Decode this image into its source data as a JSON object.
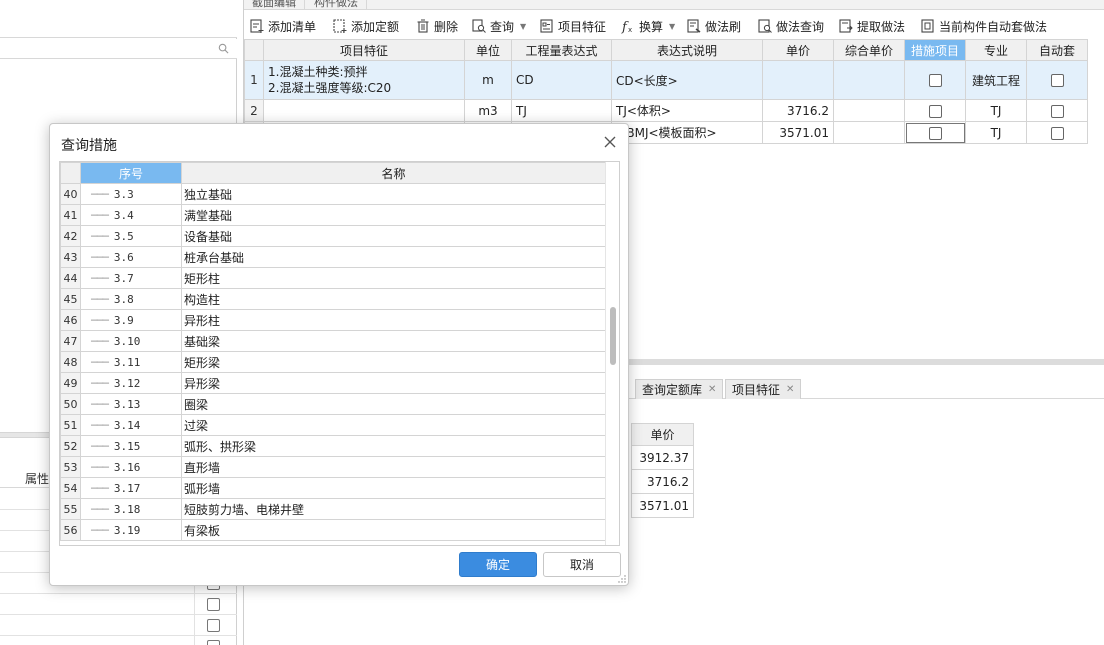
{
  "top_tabs": [
    "截面编辑",
    "构件做法"
  ],
  "toolbar": {
    "add_list": "添加清单",
    "add_quota": "添加定额",
    "delete": "删除",
    "query": "查询",
    "item_feature": "项目特征",
    "convert": "换算",
    "method_brush": "做法刷",
    "method_query": "做法查询",
    "extract_method": "提取做法",
    "auto_apply": "当前构件自动套做法"
  },
  "main_grid": {
    "headers": [
      "项目特征",
      "单位",
      "工程量表达式",
      "表达式说明",
      "单价",
      "综合单价",
      "措施项目",
      "专业",
      "自动套"
    ],
    "rows": [
      {
        "rn": "1",
        "feature_1": "1.混凝土种类:预拌",
        "feature_2": "2.混凝土强度等级:C20",
        "unit": "m",
        "expr": "CD",
        "expr_desc": "CD<长度>",
        "price": "",
        "major": "建筑工程"
      },
      {
        "rn": "2",
        "unit": "m3",
        "expr": "TJ",
        "expr_desc": "TJ<体积>",
        "price": "3716.2",
        "major": "TJ"
      },
      {
        "expr_desc": "MBMJ<模板面积>",
        "price": "3571.01",
        "major": "TJ"
      }
    ]
  },
  "left_panel": {
    "search_placeholder": "",
    "props_header": "属性"
  },
  "bottom_tabs": [
    "查询定额库",
    "项目特征"
  ],
  "bottom_grid": {
    "header": "单价",
    "values": [
      "3912.37",
      "3716.2",
      "3571.01"
    ]
  },
  "dialog": {
    "title": "查询措施",
    "col_seq": "序号",
    "col_name": "名称",
    "rows": [
      {
        "rn": "40",
        "code": "3.3",
        "name": "独立基础"
      },
      {
        "rn": "41",
        "code": "3.4",
        "name": "满堂基础"
      },
      {
        "rn": "42",
        "code": "3.5",
        "name": "设备基础"
      },
      {
        "rn": "43",
        "code": "3.6",
        "name": "桩承台基础"
      },
      {
        "rn": "44",
        "code": "3.7",
        "name": "矩形柱"
      },
      {
        "rn": "45",
        "code": "3.8",
        "name": "构造柱"
      },
      {
        "rn": "46",
        "code": "3.9",
        "name": "异形柱"
      },
      {
        "rn": "47",
        "code": "3.10",
        "name": "基础梁"
      },
      {
        "rn": "48",
        "code": "3.11",
        "name": "矩形梁"
      },
      {
        "rn": "49",
        "code": "3.12",
        "name": "异形梁"
      },
      {
        "rn": "50",
        "code": "3.13",
        "name": "圈梁"
      },
      {
        "rn": "51",
        "code": "3.14",
        "name": "过梁"
      },
      {
        "rn": "52",
        "code": "3.15",
        "name": "弧形、拱形梁"
      },
      {
        "rn": "53",
        "code": "3.16",
        "name": "直形墙"
      },
      {
        "rn": "54",
        "code": "3.17",
        "name": "弧形墙"
      },
      {
        "rn": "55",
        "code": "3.18",
        "name": "短肢剪力墙、电梯井壁"
      },
      {
        "rn": "56",
        "code": "3.19",
        "name": "有梁板"
      }
    ],
    "ok_label": "确定",
    "cancel_label": "取消"
  },
  "colors": {
    "accent": "#3b8ce0",
    "header_highlight": "#79b9f0",
    "selected_row": "#e3f0fb"
  }
}
